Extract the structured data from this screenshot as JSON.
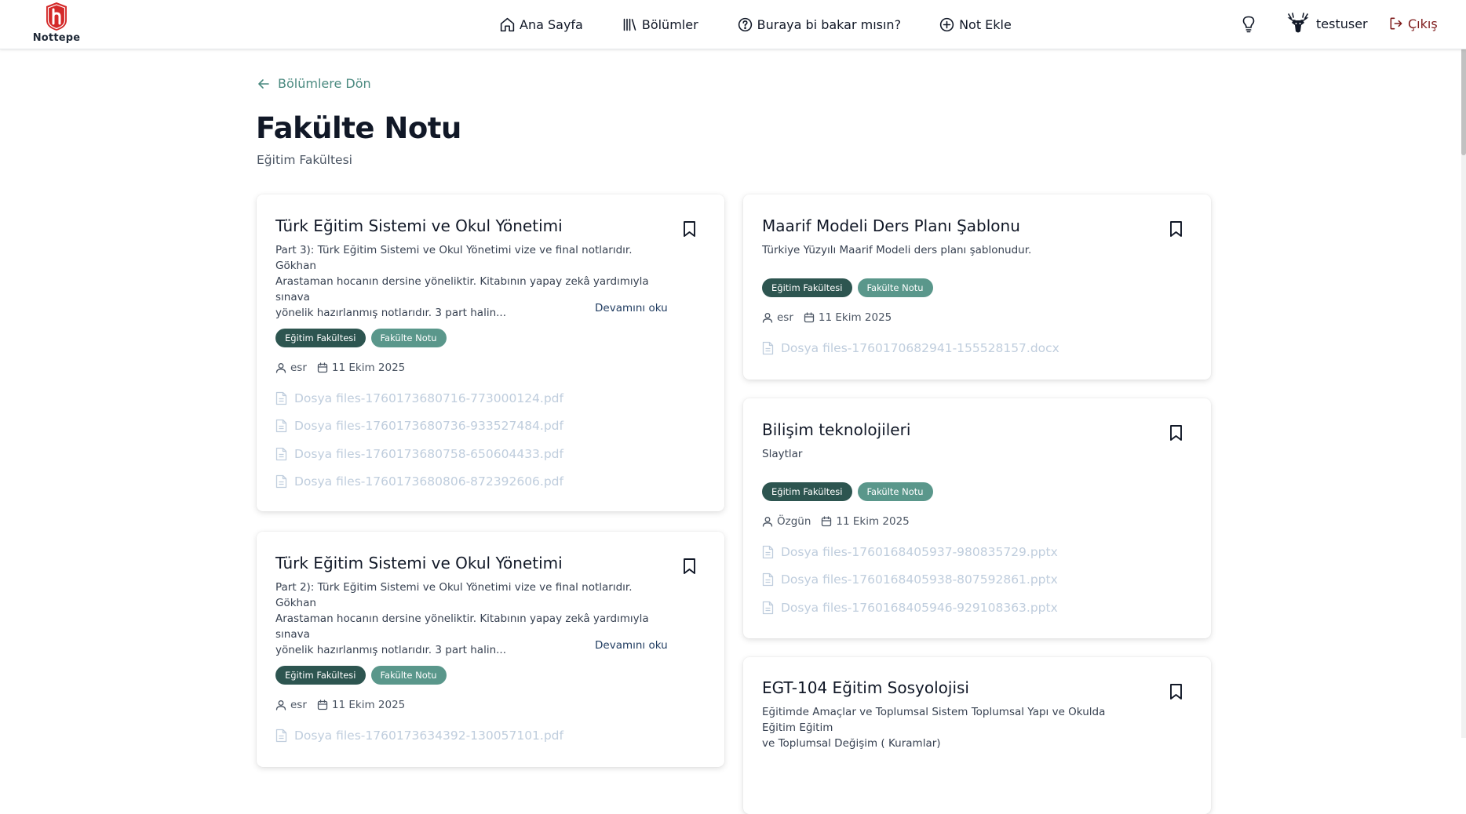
{
  "brand": {
    "name": "Nottepe"
  },
  "nav": {
    "home": "Ana Sayfa",
    "departments": "Bölümler",
    "look_here": "Buraya bi bakar mısın?",
    "add_note": "Not Ekle"
  },
  "user": {
    "username": "testuser",
    "logout": "Çıkış"
  },
  "page": {
    "back_link": "Bölümlere Dön",
    "title": "Fakülte Notu",
    "subtitle": "Eğitim Fakültesi"
  },
  "cards": [
    {
      "title": "Türk Eğitim Sistemi ve Okul Yönetimi",
      "desc_lines": [
        "Part 3): Türk Eğitim Sistemi ve Okul Yönetimi vize ve final notlarıdır. Gökhan",
        "Arastaman hocanın dersine yöneliktir. Kitabının yapay zekâ yardımıyla sınava",
        "yönelik hazırlanmış notlarıdır. 3 part halin..."
      ],
      "read_more": "Devamını oku",
      "tags": [
        "Eğitim Fakültesi",
        "Fakülte Notu"
      ],
      "author": "esr",
      "date": "11 Ekim 2025",
      "files": [
        "Dosya files-1760173680716-773000124.pdf",
        "Dosya files-1760173680736-933527484.pdf",
        "Dosya files-1760173680758-650604433.pdf",
        "Dosya files-1760173680806-872392606.pdf"
      ]
    },
    {
      "title": "Türk Eğitim Sistemi ve Okul Yönetimi",
      "desc_lines": [
        "Part 2): Türk Eğitim Sistemi ve Okul Yönetimi vize ve final notlarıdır. Gökhan",
        "Arastaman hocanın dersine yöneliktir. Kitabının yapay zekâ yardımıyla sınava",
        "yönelik hazırlanmış notlarıdır. 3 part halin..."
      ],
      "read_more": "Devamını oku",
      "tags": [
        "Eğitim Fakültesi",
        "Fakülte Notu"
      ],
      "author": "esr",
      "date": "11 Ekim 2025",
      "files": [
        "Dosya files-1760173634392-130057101.pdf"
      ]
    },
    {
      "title": "Maarif Modeli Ders Planı Şablonu",
      "desc_lines": [
        "Türkiye Yüzyılı Maarif Modeli ders planı şablonudur."
      ],
      "tags": [
        "Eğitim Fakültesi",
        "Fakülte Notu"
      ],
      "author": "esr",
      "date": "11 Ekim 2025",
      "files": [
        "Dosya files-1760170682941-155528157.docx"
      ]
    },
    {
      "title": "Bilişim teknolojileri",
      "desc_lines": [
        "Slaytlar"
      ],
      "tags": [
        "Eğitim Fakültesi",
        "Fakülte Notu"
      ],
      "author": "Özgün",
      "date": "11 Ekim 2025",
      "files": [
        "Dosya files-1760168405937-980835729.pptx",
        "Dosya files-1760168405938-807592861.pptx",
        "Dosya files-1760168405946-929108363.pptx"
      ]
    },
    {
      "title": "EGT-104 Eğitim Sosyolojisi",
      "desc_lines": [
        "Eğitimde Amaçlar ve Toplumsal Sistem Toplumsal Yapı ve Okulda Eğitim Eğitim",
        "ve Toplumsal Değişim ( Kuramlar)"
      ]
    }
  ]
}
